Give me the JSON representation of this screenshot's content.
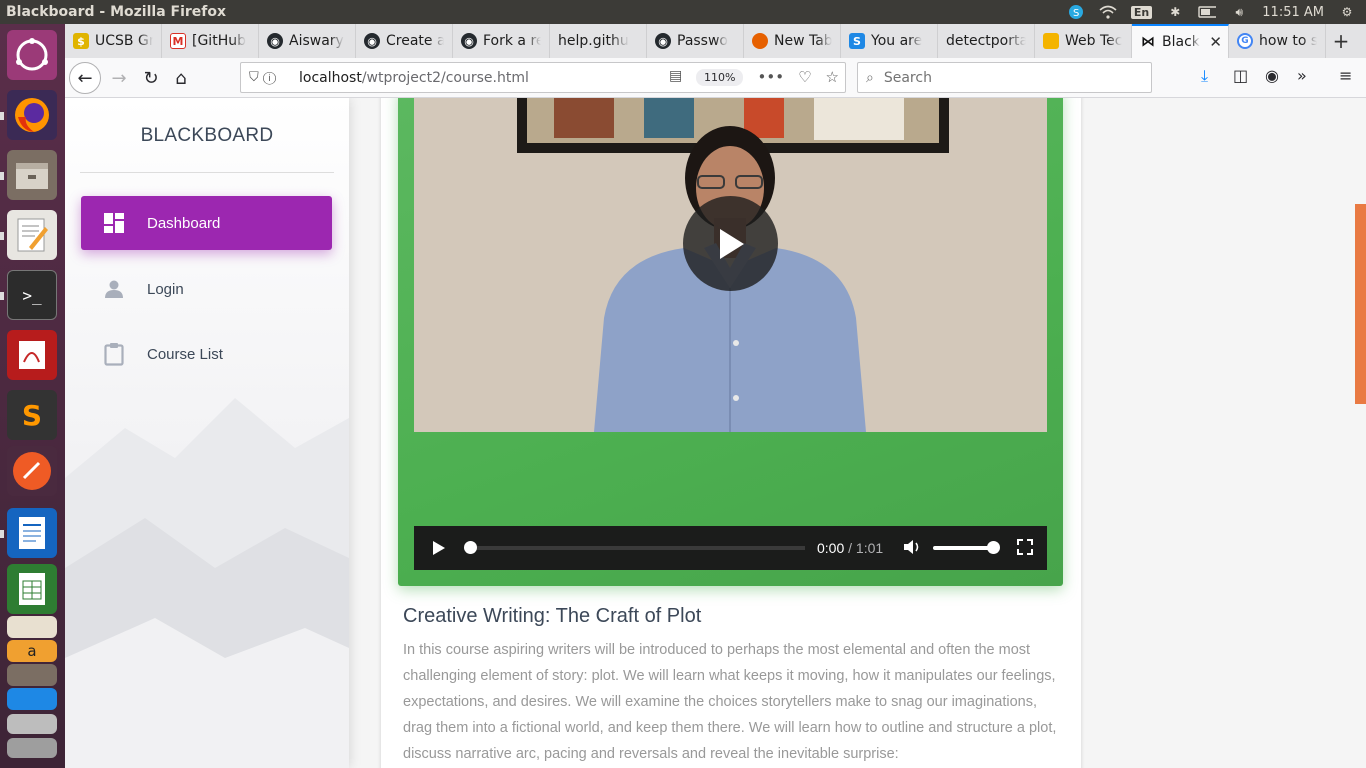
{
  "system": {
    "window_title": "Blackboard - Mozilla Firefox",
    "lang": "En",
    "clock": "11:51 AM"
  },
  "browser": {
    "tabs": [
      {
        "label": "UCSB Gr",
        "icon": "ucsb-icon",
        "color": "#e0b400"
      },
      {
        "label": "[GitHub",
        "icon": "gmail-icon",
        "color": "#d93025"
      },
      {
        "label": "Aiswary",
        "icon": "github-icon",
        "color": "#24292e"
      },
      {
        "label": "Create a",
        "icon": "github-icon",
        "color": "#24292e"
      },
      {
        "label": "Fork a re",
        "icon": "github-icon",
        "color": "#24292e"
      },
      {
        "label": "help.githu",
        "icon": "none",
        "color": "#e3e3e5"
      },
      {
        "label": "Passwo",
        "icon": "github-icon",
        "color": "#24292e"
      },
      {
        "label": "New Tab",
        "icon": "firefox-icon",
        "color": "#e66000"
      },
      {
        "label": "You are",
        "icon": "stackoverflow-icon",
        "color": "#1e88e5"
      },
      {
        "label": "detectporta",
        "icon": "none",
        "color": "#e3e3e5"
      },
      {
        "label": "Web Tec",
        "icon": "slides-icon",
        "color": "#f4b400"
      },
      {
        "label": "Black",
        "icon": "bow-icon",
        "color": "#111111",
        "active": true
      },
      {
        "label": "how to s",
        "icon": "google-icon",
        "color": "#4285f4"
      }
    ],
    "url_host": "localhost",
    "url_path": "/wtproject2/course.html",
    "zoom": "110%",
    "search_placeholder": "Search"
  },
  "sidebar": {
    "brand": "BLACKBOARD",
    "items": [
      {
        "label": "Dashboard",
        "icon": "dashboard-icon",
        "active": true
      },
      {
        "label": "Login",
        "icon": "person-icon"
      },
      {
        "label": "Course List",
        "icon": "clipboard-icon"
      }
    ],
    "accent": "#9c27b0"
  },
  "video": {
    "current_time": "0:00",
    "duration": "/ 1:01",
    "progress": 0,
    "volume": 1.0,
    "frame_color": "#4caf50"
  },
  "course": {
    "title": "Creative Writing: The Craft of Plot",
    "description": "In this course aspiring writers will be introduced to perhaps the most elemental and often the most challenging element of story: plot. We will learn what keeps it moving, how it manipulates our feelings, expectations, and desires. We will examine the choices storytellers make to snag our imaginations, drag them into a fictional world, and keep them there. We will learn how to outline and structure a plot, discuss narrative arc, pacing and reversals and reveal the inevitable surprise:"
  }
}
